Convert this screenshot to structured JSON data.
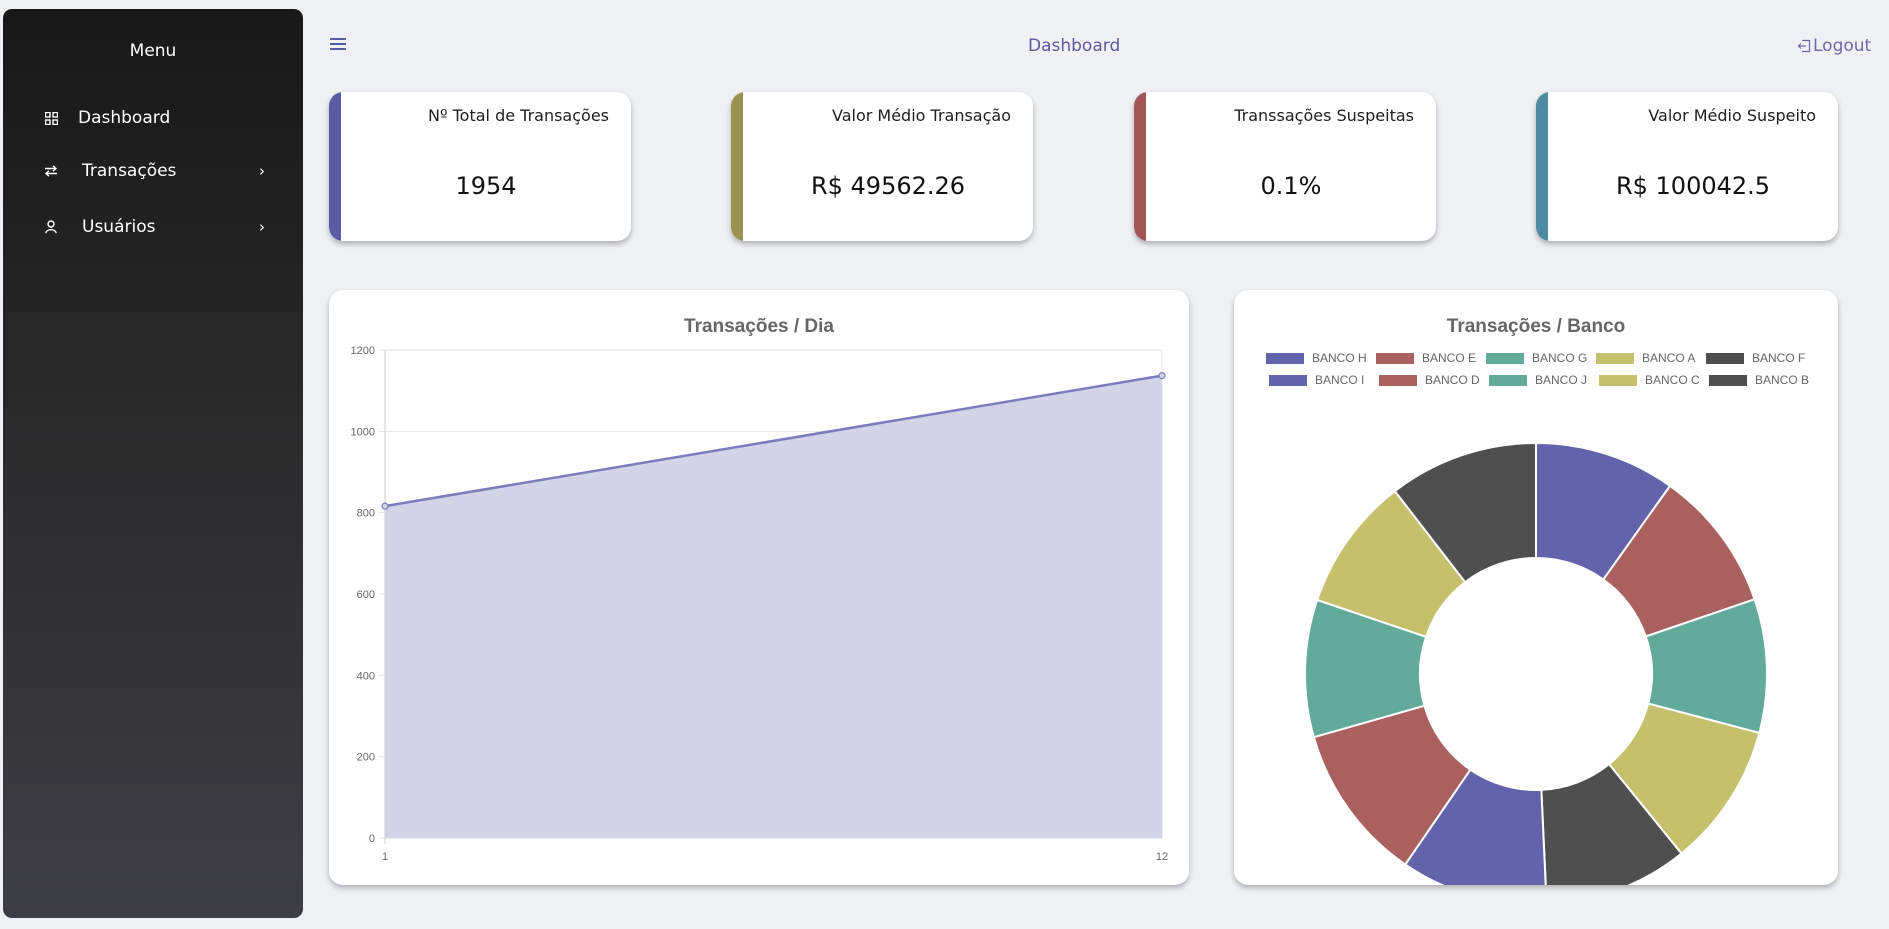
{
  "sidebar": {
    "title": "Menu",
    "items": [
      {
        "label": "Dashboard",
        "icon": "grid-icon"
      },
      {
        "label": "Transações",
        "icon": "transfer-icon"
      },
      {
        "label": "Usuários",
        "icon": "user-icon"
      }
    ]
  },
  "topbar": {
    "title": "Dashboard",
    "logout_label": "Logout"
  },
  "kpis": [
    {
      "title": "Nº Total de Transações",
      "value": "1954",
      "color": "#5b5ba3"
    },
    {
      "title": "Valor Médio Transação",
      "value": "R$ 49562.26",
      "color": "#9b9150"
    },
    {
      "title": "Transsações Suspeitas",
      "value": "0.1%",
      "color": "#a35656"
    },
    {
      "title": "Valor Médio Suspeito",
      "value": "R$ 100042.5",
      "color": "#4d8aa0"
    }
  ],
  "chart_data": [
    {
      "type": "area",
      "title": "Transações /  Dia",
      "x": [
        "1",
        "12"
      ],
      "values": [
        816,
        1137
      ],
      "ylim": [
        0,
        1200
      ],
      "yticks": [
        0,
        200,
        400,
        600,
        800,
        1000,
        1200
      ],
      "color": "#7b7bbd",
      "fill": "#d3d4e8",
      "grid": true
    },
    {
      "type": "pie",
      "title": "Transações /  Banco",
      "legend_position": "top",
      "categories": [
        "BANCO H",
        "BANCO E",
        "BANCO G",
        "BANCO A",
        "BANCO F",
        "BANCO I",
        "BANCO D",
        "BANCO J",
        "BANCO C",
        "BANCO B"
      ],
      "colors": [
        "#6263ab",
        "#ab6060",
        "#62aa9a",
        "#c4c06b",
        "#4f4f4f",
        "#6263ab",
        "#ab6060",
        "#62aa9a",
        "#c4c06b",
        "#4f4f4f"
      ],
      "values": [
        195,
        196,
        185,
        199,
        200,
        204,
        218,
        190,
        185,
        207
      ]
    }
  ]
}
